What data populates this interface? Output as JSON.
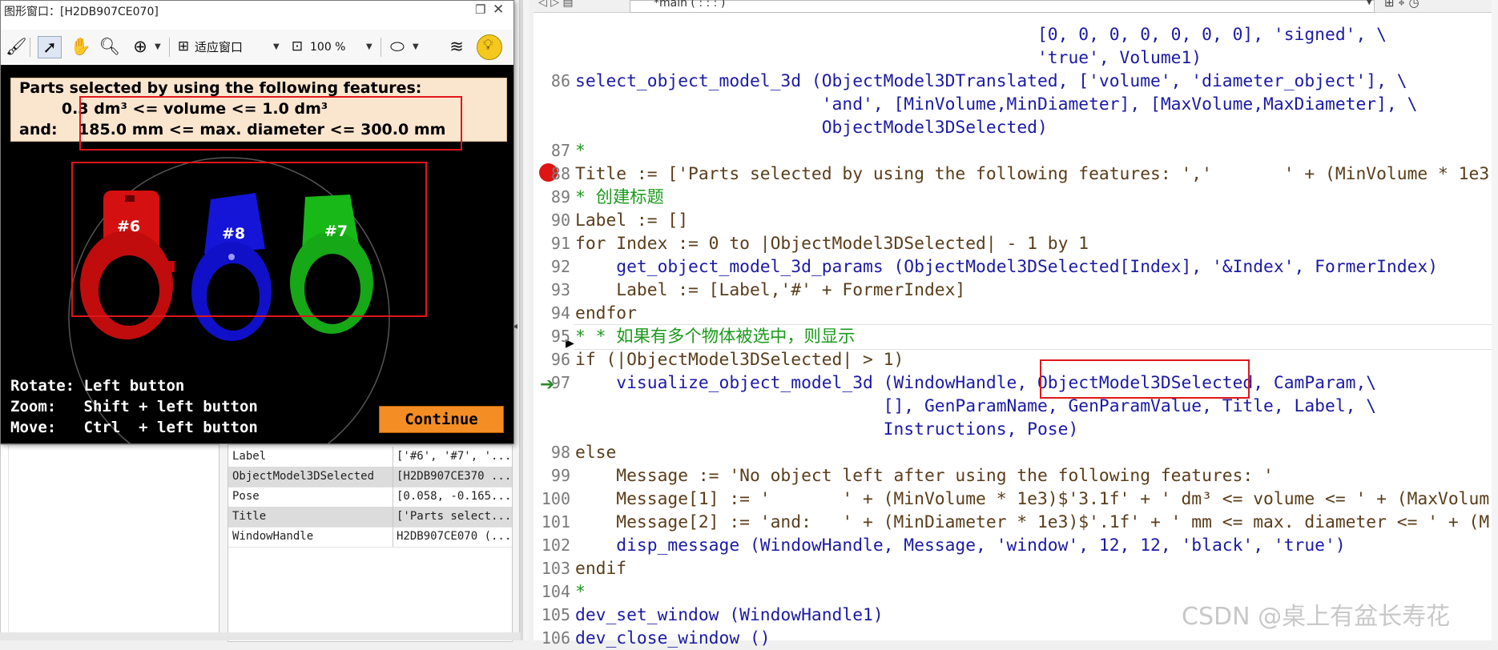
{
  "graphics_window": {
    "title": "图形窗口：[H2DB907CE070]",
    "toolbar": {
      "fit_label": "适应窗口",
      "zoom_value": "100 %"
    },
    "feature_header": "Parts selected by using the following features:",
    "feature_line1": "        0.3 dm³ <= volume <= 1.0 dm³",
    "feature_line2": "and:    185.0 mm <= max. diameter <= 300.0 mm",
    "parts": [
      {
        "label": "#6",
        "color": "#e01010"
      },
      {
        "label": "#8",
        "color": "#1414e0"
      },
      {
        "label": "#7",
        "color": "#18c418"
      }
    ],
    "instructions": [
      "Rotate: Left button",
      "Zoom:   Shift + left button",
      "Move:   Ctrl  + left button"
    ],
    "continue_label": "Continue"
  },
  "variables": [
    {
      "name": "Label",
      "value": "['#6', '#7', '..."
    },
    {
      "name": "ObjectModel3DSelected",
      "value": "[H2DB907CE370 ..."
    },
    {
      "name": "Pose",
      "value": "[0.058, -0.165..."
    },
    {
      "name": "Title",
      "value": "['Parts select..."
    },
    {
      "name": "WindowHandle",
      "value": "H2DB907CE070 (..."
    }
  ],
  "editor": {
    "procedure_combo": "*main ( : : : )",
    "lines": [
      {
        "num": "",
        "text": "                                             [0, 0, 0, 0, 0, 0, 0], 'signed', \\"
      },
      {
        "num": "",
        "text": "                                             'true', Volume1)"
      },
      {
        "num": "86",
        "text": "select_object_model_3d (ObjectModel3DTranslated, ['volume', 'diameter_object'], \\"
      },
      {
        "num": "",
        "text": "                        'and', [MinVolume,MinDiameter], [MaxVolume,MaxDiameter], \\"
      },
      {
        "num": "",
        "text": "                        ObjectModel3DSelected)"
      },
      {
        "num": "87",
        "text": "*"
      },
      {
        "num": "88",
        "text": "Title := ['Parts selected by using the following features: ','       ' + (MinVolume * 1e3"
      },
      {
        "num": "89",
        "text": "* 创建标题"
      },
      {
        "num": "90",
        "text": "Label := []"
      },
      {
        "num": "91",
        "text": "for Index := 0 to |ObjectModel3DSelected| - 1 by 1"
      },
      {
        "num": "92",
        "text": "    get_object_model_3d_params (ObjectModel3DSelected[Index], '&Index', FormerIndex)"
      },
      {
        "num": "93",
        "text": "    Label := [Label,'#' + FormerIndex]"
      },
      {
        "num": "94",
        "text": "endfor"
      },
      {
        "num": "95",
        "text": "* * 如果有多个物体被选中，则显示"
      },
      {
        "num": "96",
        "text": "if (|ObjectModel3DSelected| > 1)"
      },
      {
        "num": "97",
        "text": "    visualize_object_model_3d (WindowHandle, ObjectModel3DSelected, CamParam,\\"
      },
      {
        "num": "",
        "text": "                              [], GenParamName, GenParamValue, Title, Label, \\"
      },
      {
        "num": "",
        "text": "                              Instructions, Pose)"
      },
      {
        "num": "98",
        "text": "else"
      },
      {
        "num": "99",
        "text": "    Message := 'No object left after using the following features: '"
      },
      {
        "num": "100",
        "text": "    Message[1] := '       ' + (MinVolume * 1e3)$'3.1f' + ' dm³ <= volume <= ' + (MaxVolum"
      },
      {
        "num": "101",
        "text": "    Message[2] := 'and:   ' + (MinDiameter * 1e3)$'.1f' + ' mm <= max. diameter <= ' + (M"
      },
      {
        "num": "102",
        "text": "    disp_message (WindowHandle, Message, 'window', 12, 12, 'black', 'true')"
      },
      {
        "num": "103",
        "text": "endif"
      },
      {
        "num": "104",
        "text": "*"
      },
      {
        "num": "105",
        "text": "dev_set_window (WindowHandle1)"
      },
      {
        "num": "106",
        "text": "dev_close_window ()"
      }
    ],
    "watermark": "CSDN @桌上有盆长寿花"
  },
  "colors": {
    "highlight_red": "#e0161b",
    "continue_orange": "#f38d24",
    "feature_box": "#fae6cf",
    "breakpoint": "#e01414"
  }
}
